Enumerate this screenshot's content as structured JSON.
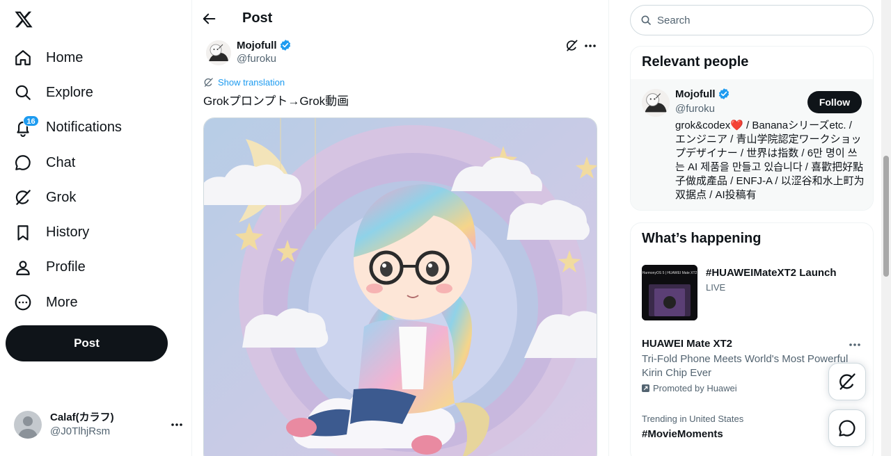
{
  "nav": {
    "items": [
      {
        "label": "Home",
        "icon": "home-icon"
      },
      {
        "label": "Explore",
        "icon": "search-icon"
      },
      {
        "label": "Notifications",
        "icon": "bell-icon",
        "badge": "16"
      },
      {
        "label": "Chat",
        "icon": "chat-icon"
      },
      {
        "label": "Grok",
        "icon": "grok-icon"
      },
      {
        "label": "History",
        "icon": "bookmark-icon"
      },
      {
        "label": "Profile",
        "icon": "person-icon"
      },
      {
        "label": "More",
        "icon": "more-circle-icon"
      }
    ],
    "post_button": "Post"
  },
  "account": {
    "name": "Calaf(カラフ)",
    "handle": "@J0TlhjRsm"
  },
  "header": {
    "title": "Post"
  },
  "tweet": {
    "author_name": "Mojofull",
    "author_handle": "@furoku",
    "show_translation": "Show translation",
    "text": "Grokプロンプト→Grok動画"
  },
  "search": {
    "placeholder": "Search"
  },
  "relevant": {
    "title": "Relevant people",
    "name": "Mojofull",
    "handle": "@furoku",
    "follow": "Follow",
    "bio": "grok&codex❤️ / Bananaシリーズetc. / エンジニア / 青山学院認定ワークショップデザイナー / 世界は指数 / 6만 명이 쓰는 AI 제품을 만들고 있습니다 / 喜歡把好點子做成產品 / ENFJ-A / 以涩谷和水上町为双据点 / AI投稿有"
  },
  "happening": {
    "title": "What’s happening",
    "trend1_title": "#HUAWEIMateXT2 Launch",
    "trend1_status": "LIVE",
    "trend1_image_caption": "HarmonyOS 5 | HUAWEI Mate XT2",
    "promo_title": "HUAWEI Mate XT2",
    "promo_desc": "Tri-Fold Phone Meets World's Most Powerful Kirin Chip Ever",
    "promo_by": "Promoted by Huawei",
    "trend3_context": "Trending in United States",
    "trend3_tag": "#MovieMoments"
  },
  "colors": {
    "accent": "#1d9bf0",
    "text": "#0f1419",
    "muted": "#536471",
    "border": "#eff3f4"
  }
}
